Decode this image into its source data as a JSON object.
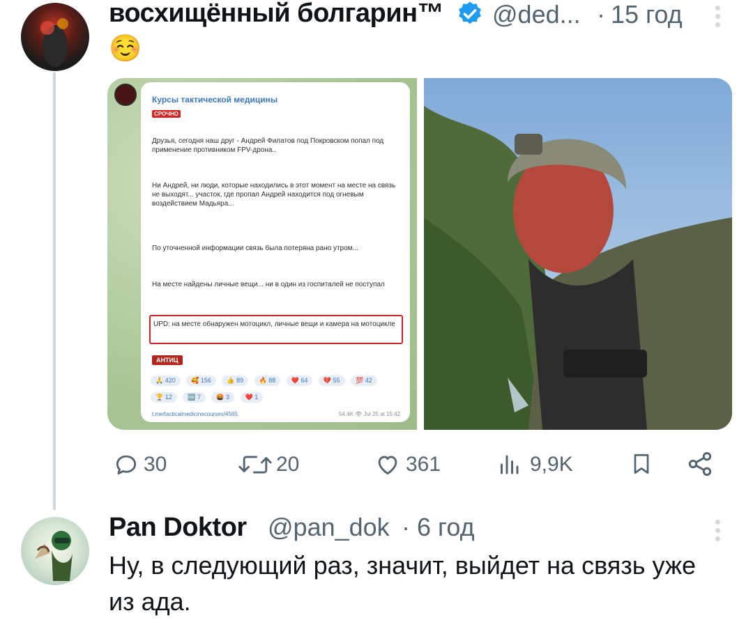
{
  "tweet": {
    "author_name": "восхищённый болгарин™",
    "handle": "@ded...",
    "separator": "·",
    "time": "15 год",
    "text": "☺️",
    "verified": true,
    "media": {
      "telegram_post": {
        "channel": "Курсы тактической медицины",
        "badge": "СРОЧНО",
        "paragraph_1": "Друзья, сегодня наш друг - Андрей Филатов под Покровском попал под применение противником FPV-дрона..",
        "paragraph_2": "Ни Андрей, ни люди, которые находились в этот момент на месте на связь не выходят... участок, где пропал Андрей находится под огневым воздействием Мадьяра...",
        "paragraph_3": "По уточненной информации связь была потеряна рано утром...",
        "paragraph_4": "На месте найдены личные вещи... ни в один из госпиталей не поступал",
        "upd": "UPD: на месте обнаружен мотоцикл, личные вещи и камера на мотоцикле",
        "sticker": "АНТИЦ",
        "reactions": [
          "🙏 420",
          "🥰 156",
          "👍 89",
          "🔥 88",
          "❤️ 64",
          "💔 55",
          "💯 42",
          "🏆 12",
          "🆒 7",
          "🤬 3",
          "❤️ 1"
        ],
        "link": "t.me/tacticalmedicinecourses/4565",
        "views_date": "54.4K 👁 Jul 25 at 15:42"
      }
    },
    "actions": {
      "replies": "30",
      "reposts": "20",
      "likes": "361",
      "views": "9,9K"
    },
    "icons": [
      "reply-icon",
      "repost-icon",
      "like-icon",
      "views-icon",
      "bookmark-icon",
      "share-icon",
      "verified-badge-icon",
      "more-icon"
    ],
    "colors": {
      "verified": "#1d9bf0",
      "secondary_text": "#536471",
      "thread_line": "#cfd9de"
    }
  },
  "reply": {
    "author_name": "Pan Doktor",
    "handle": "@pan_dok",
    "separator": "·",
    "time": "6 год",
    "text": "Ну, в следующий раз, значит, выйдет на связь уже из ада."
  }
}
